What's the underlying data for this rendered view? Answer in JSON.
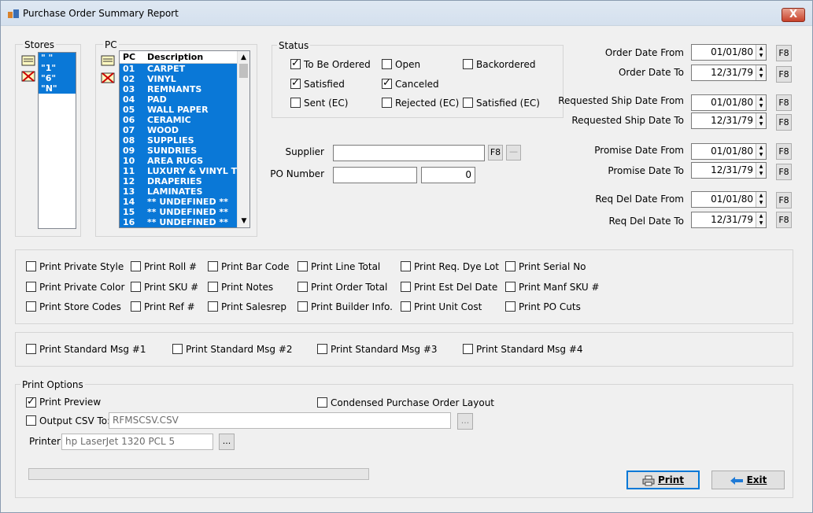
{
  "window": {
    "title": "Purchase Order Summary Report",
    "close_glyph": "X"
  },
  "stores": {
    "label": "Stores",
    "items": [
      "\" \"",
      "\"1\"",
      "\"6\"",
      "\"N\""
    ]
  },
  "pc": {
    "label": "PC",
    "col_code": "PC",
    "col_desc": "Description",
    "rows": [
      {
        "code": "01",
        "desc": "CARPET"
      },
      {
        "code": "02",
        "desc": "VINYL"
      },
      {
        "code": "03",
        "desc": "REMNANTS"
      },
      {
        "code": "04",
        "desc": "PAD"
      },
      {
        "code": "05",
        "desc": "WALL PAPER"
      },
      {
        "code": "06",
        "desc": "CERAMIC"
      },
      {
        "code": "07",
        "desc": "WOOD"
      },
      {
        "code": "08",
        "desc": "SUPPLIES"
      },
      {
        "code": "09",
        "desc": "SUNDRIES"
      },
      {
        "code": "10",
        "desc": "AREA RUGS"
      },
      {
        "code": "11",
        "desc": "LUXURY & VINYL TILE"
      },
      {
        "code": "12",
        "desc": "DRAPERIES"
      },
      {
        "code": "13",
        "desc": "LAMINATES"
      },
      {
        "code": "14",
        "desc": "** UNDEFINED **"
      },
      {
        "code": "15",
        "desc": "** UNDEFINED **"
      },
      {
        "code": "16",
        "desc": "** UNDEFINED **"
      }
    ]
  },
  "status": {
    "label": "Status",
    "to_be_ordered": "To Be Ordered",
    "open": "Open",
    "backordered": "Backordered",
    "satisfied": "Satisfied",
    "canceled": "Canceled",
    "sent_ec": "Sent (EC)",
    "rejected_ec": "Rejected (EC)",
    "satisfied_ec": "Satisfied (EC)"
  },
  "supplier": {
    "label": "Supplier",
    "value": "",
    "f8": "F8",
    "dash": "—"
  },
  "po_number": {
    "label": "PO Number",
    "from": "",
    "to": "0"
  },
  "dates": {
    "f8": "F8",
    "order_from_label": "Order Date From",
    "order_from": "01/01/80",
    "order_to_label": "Order Date To",
    "order_to": "12/31/79",
    "req_ship_from_label": "Requested Ship Date From",
    "req_ship_from": "01/01/80",
    "req_ship_to_label": "Requested Ship Date To",
    "req_ship_to": "12/31/79",
    "promise_from_label": "Promise Date From",
    "promise_from": "01/01/80",
    "promise_to_label": "Promise Date To",
    "promise_to": "12/31/79",
    "req_del_from_label": "Req Del Date From",
    "req_del_from": "01/01/80",
    "req_del_to_label": "Req Del Date To",
    "req_del_to": "12/31/79"
  },
  "print_fields": {
    "private_style": "Print Private Style",
    "roll": "Print Roll #",
    "bar_code": "Print Bar Code",
    "line_total": "Print Line Total",
    "req_dye_lot": "Print Req. Dye Lot",
    "serial_no": "Print Serial No",
    "private_color": "Print Private Color",
    "sku": "Print SKU #",
    "notes": "Print Notes",
    "order_total": "Print Order Total",
    "est_del_date": "Print Est Del Date",
    "manf_sku": "Print Manf SKU #",
    "store_codes": "Print Store Codes",
    "ref": "Print Ref #",
    "salesrep": "Print Salesrep",
    "builder_info": "Print Builder Info.",
    "unit_cost": "Print Unit Cost",
    "po_cuts": "Print PO Cuts"
  },
  "std_msgs": {
    "m1": "Print Standard Msg #1",
    "m2": "Print Standard Msg #2",
    "m3": "Print Standard Msg #3",
    "m4": "Print Standard Msg #4"
  },
  "print_options": {
    "label": "Print Options",
    "preview": "Print Preview",
    "condensed": "Condensed Purchase Order Layout",
    "output_csv": "Output CSV To:",
    "csv_value": "RFMSCSV.CSV",
    "browse": "...",
    "printer_label": "Printer",
    "printer_value": "hp LaserJet 1320 PCL 5"
  },
  "progress": 0,
  "buttons": {
    "print": "Print",
    "exit": "Exit"
  }
}
